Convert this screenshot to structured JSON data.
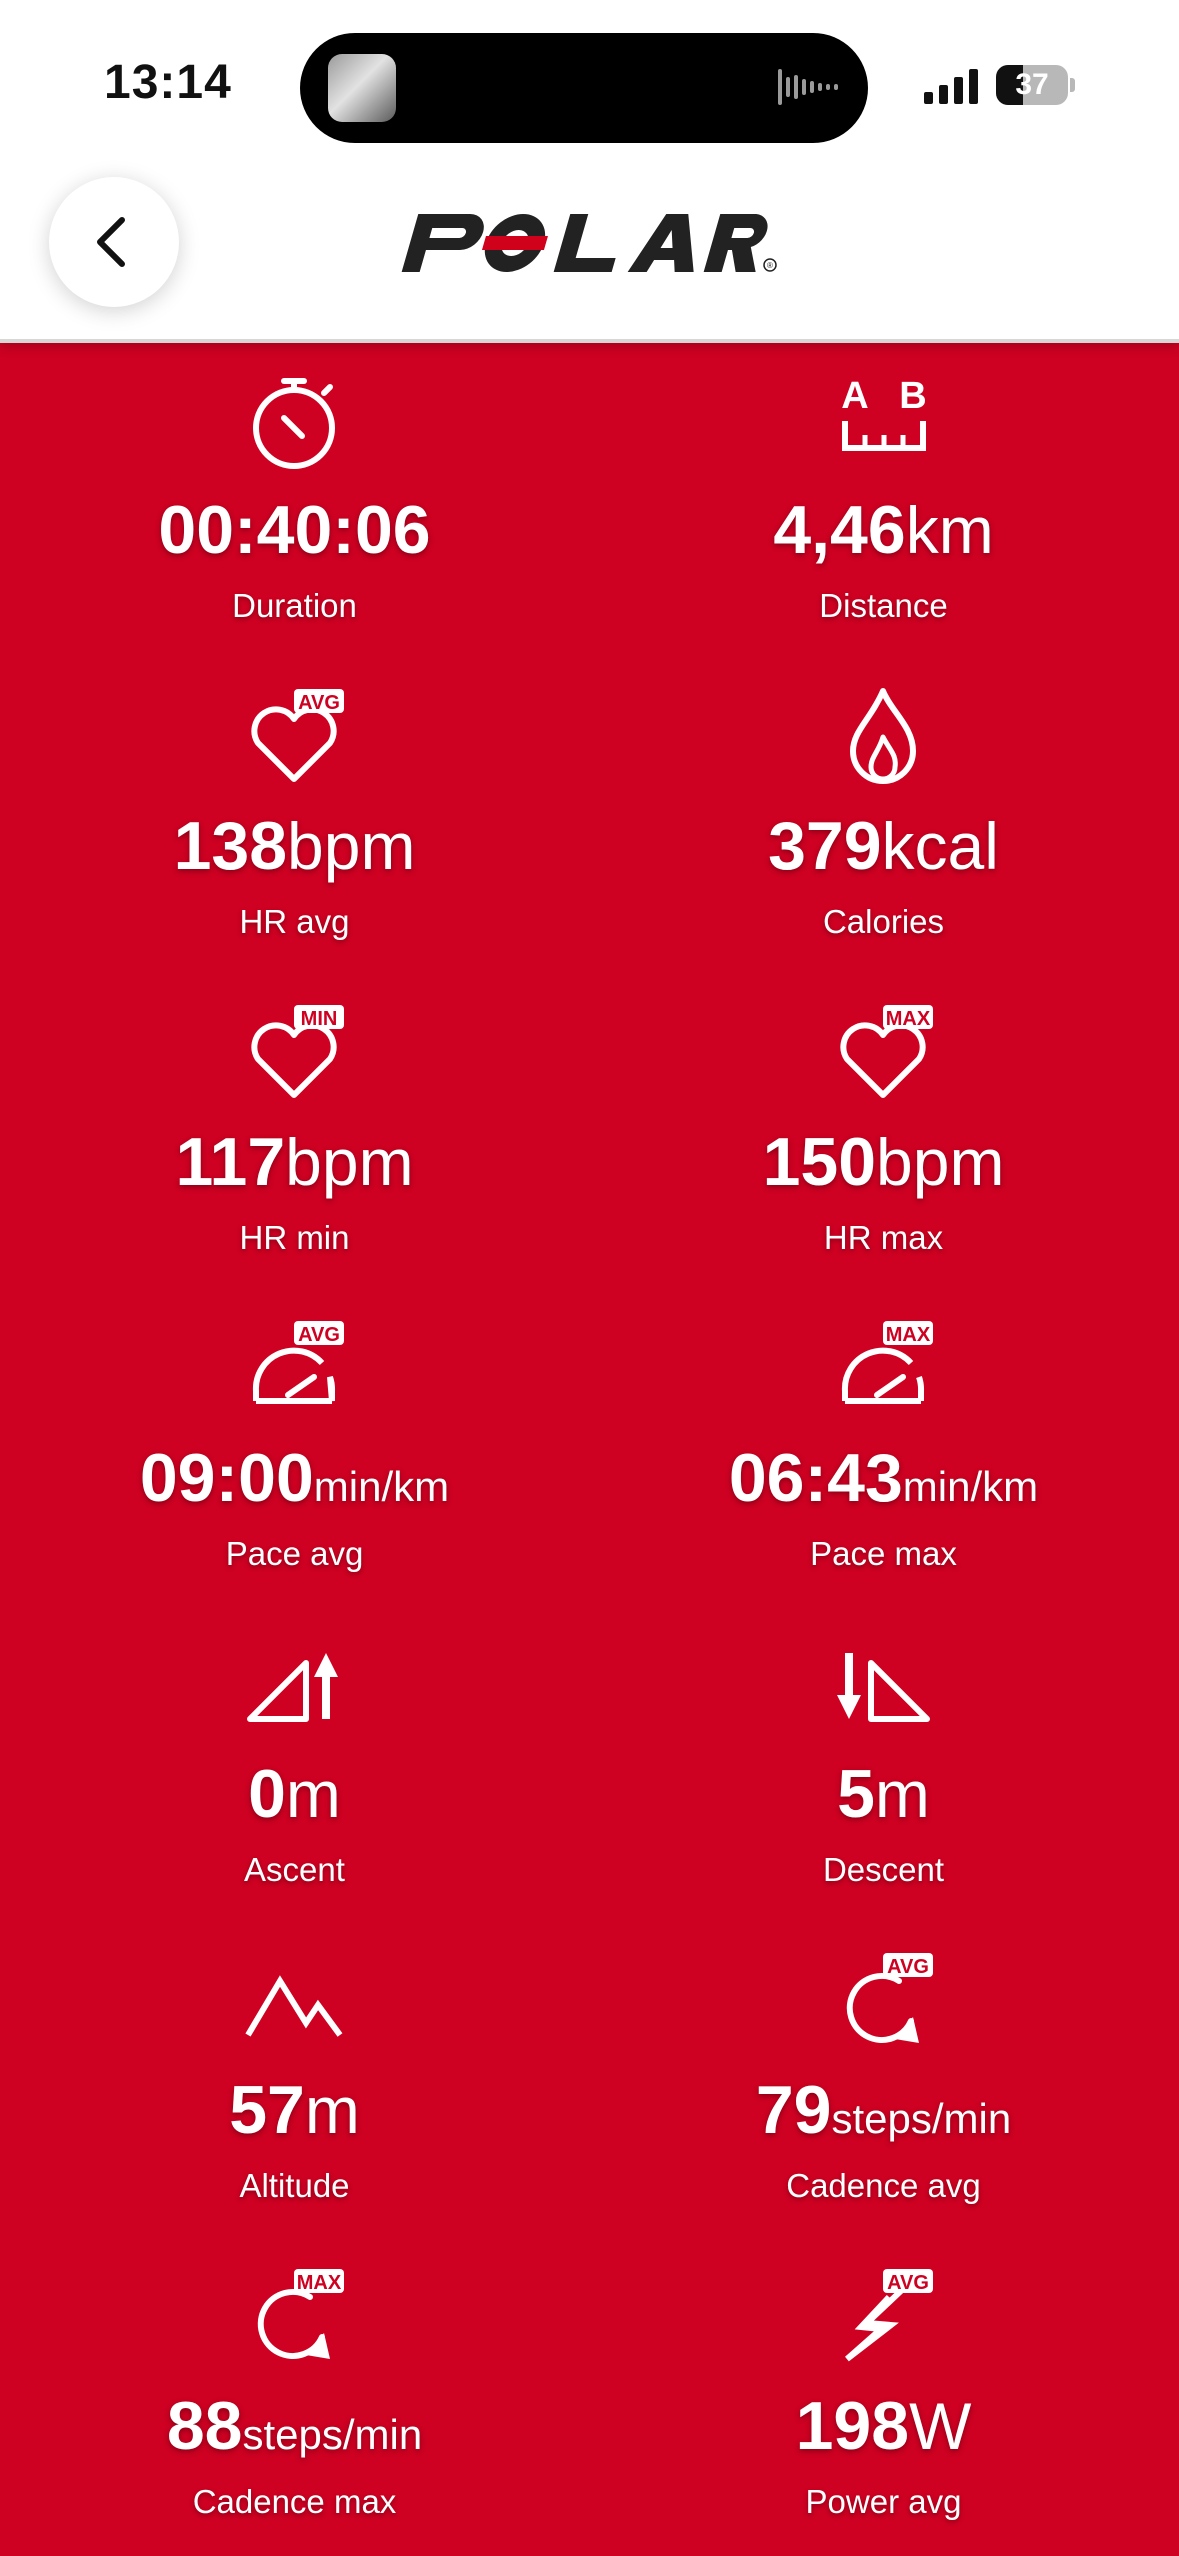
{
  "status_bar": {
    "time": "13:14",
    "battery": "37"
  },
  "header": {
    "logo_text": "POLAR",
    "registered_mark": "®"
  },
  "stats": [
    {
      "value": "00:40:06",
      "unit": "",
      "label": "Duration",
      "icon": "stopwatch-icon"
    },
    {
      "value": "4,46",
      "unit": "km",
      "label": "Distance",
      "icon": "distance-ab-icon"
    },
    {
      "value": "138",
      "unit": "bpm",
      "label": "HR avg",
      "icon": "heart-avg-icon",
      "badge": "AVG"
    },
    {
      "value": "379",
      "unit": "kcal",
      "label": "Calories",
      "icon": "flame-icon"
    },
    {
      "value": "117",
      "unit": "bpm",
      "label": "HR min",
      "icon": "heart-min-icon",
      "badge": "MIN"
    },
    {
      "value": "150",
      "unit": "bpm",
      "label": "HR max",
      "icon": "heart-max-icon",
      "badge": "MAX"
    },
    {
      "value": "09:00",
      "unit": "min/km",
      "label": "Pace avg",
      "icon": "pace-avg-icon",
      "badge": "AVG"
    },
    {
      "value": "06:43",
      "unit": "min/km",
      "label": "Pace max",
      "icon": "pace-max-icon",
      "badge": "MAX"
    },
    {
      "value": "0",
      "unit": "m",
      "label": "Ascent",
      "icon": "ascent-icon"
    },
    {
      "value": "5",
      "unit": "m",
      "label": "Descent",
      "icon": "descent-icon"
    },
    {
      "value": "57",
      "unit": "m",
      "label": "Altitude",
      "icon": "mountain-icon"
    },
    {
      "value": "79",
      "unit": "steps/min",
      "label": "Cadence avg",
      "icon": "cadence-avg-icon",
      "badge": "AVG"
    },
    {
      "value": "88",
      "unit": "steps/min",
      "label": "Cadence max",
      "icon": "cadence-max-icon",
      "badge": "MAX"
    },
    {
      "value": "198",
      "unit": "W",
      "label": "Power avg",
      "icon": "power-avg-icon",
      "badge": "AVG"
    }
  ],
  "colors": {
    "background": "#ce0122",
    "header": "#ffffff",
    "text": "#ffffff",
    "logo": "#222222",
    "logo_accent": "#d0021b"
  }
}
